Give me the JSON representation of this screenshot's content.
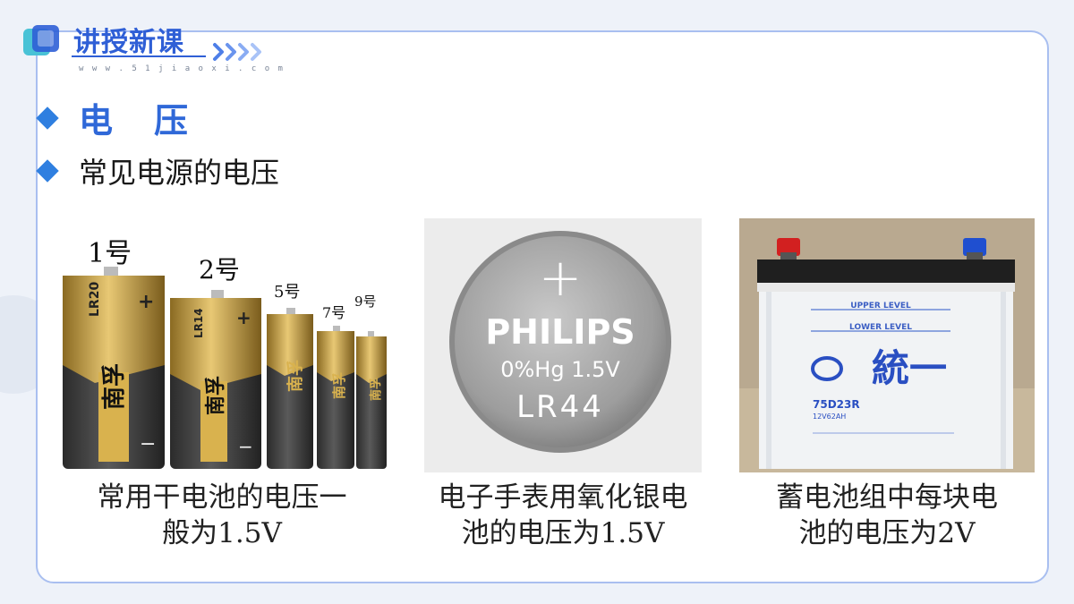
{
  "header": {
    "title": "讲授新课",
    "url": "w w w . 5 1 j i a o x i . c o m"
  },
  "section": {
    "title": "电压",
    "subtitle": "常见电源的电压"
  },
  "panels": [
    {
      "size_labels": [
        "1号",
        "2号",
        "5号",
        "7号",
        "9号"
      ],
      "battery_codes": [
        "LR20",
        "LR14"
      ],
      "battery_brand": "南孚",
      "caption_line1": "常用干电池的电压一",
      "caption_line2": "般为1.5V"
    },
    {
      "plus": "+",
      "brand": "PHILIPS",
      "spec": "0%Hg 1.5V",
      "model": "LR44",
      "caption_line1": "电子手表用氧化银电",
      "caption_line2": "池的电压为1.5V"
    },
    {
      "upper_level": "UPPER LEVEL",
      "lower_level": "LOWER LEVEL",
      "brand": "統一",
      "model": "75D23R",
      "spec": "12V62AH",
      "caption_line1": "蓄电池组中每块电",
      "caption_line2": "池的电压为2V"
    }
  ],
  "colors": {
    "accent": "#2f68d8",
    "battery_gold": "#c9a24a",
    "battery_dark": "#3a3a3a",
    "card_border": "#a9bff0"
  }
}
